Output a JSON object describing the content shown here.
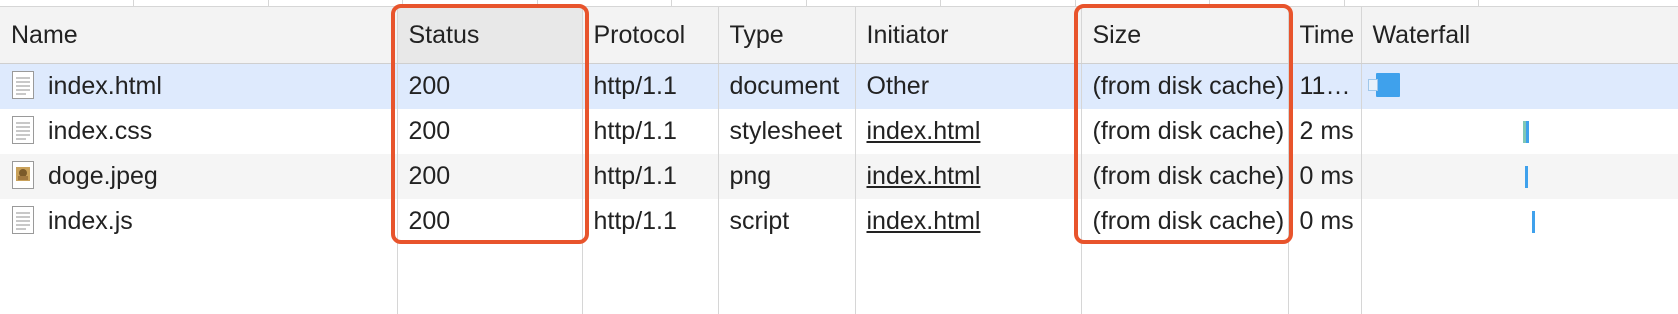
{
  "columns": {
    "name": "Name",
    "status": "Status",
    "protocol": "Protocol",
    "type": "Type",
    "initiator": "Initiator",
    "size": "Size",
    "time": "Time",
    "waterfall": "Waterfall"
  },
  "rows": [
    {
      "name": "index.html",
      "icon": "document-file-icon",
      "status": "200",
      "protocol": "http/1.1",
      "type": "document",
      "initiator": "Other",
      "size": "(from disk cache)",
      "time": "11…"
    },
    {
      "name": "index.css",
      "icon": "stylesheet-file-icon",
      "status": "200",
      "protocol": "http/1.1",
      "type": "stylesheet",
      "initiator": "index.html",
      "size": "(from disk cache)",
      "time": "2 ms"
    },
    {
      "name": "doge.jpeg",
      "icon": "image-file-icon",
      "status": "200",
      "protocol": "http/1.1",
      "type": "png",
      "initiator": "index.html",
      "size": "(from disk cache)",
      "time": "0 ms"
    },
    {
      "name": "index.js",
      "icon": "script-file-icon",
      "status": "200",
      "protocol": "http/1.1",
      "type": "script",
      "initiator": "index.html",
      "size": "(from disk cache)",
      "time": "0 ms"
    }
  ],
  "colors": {
    "highlight": "#e8542c",
    "selected_row": "#deeafd",
    "waterfall_bar": "#3fa1ec"
  }
}
